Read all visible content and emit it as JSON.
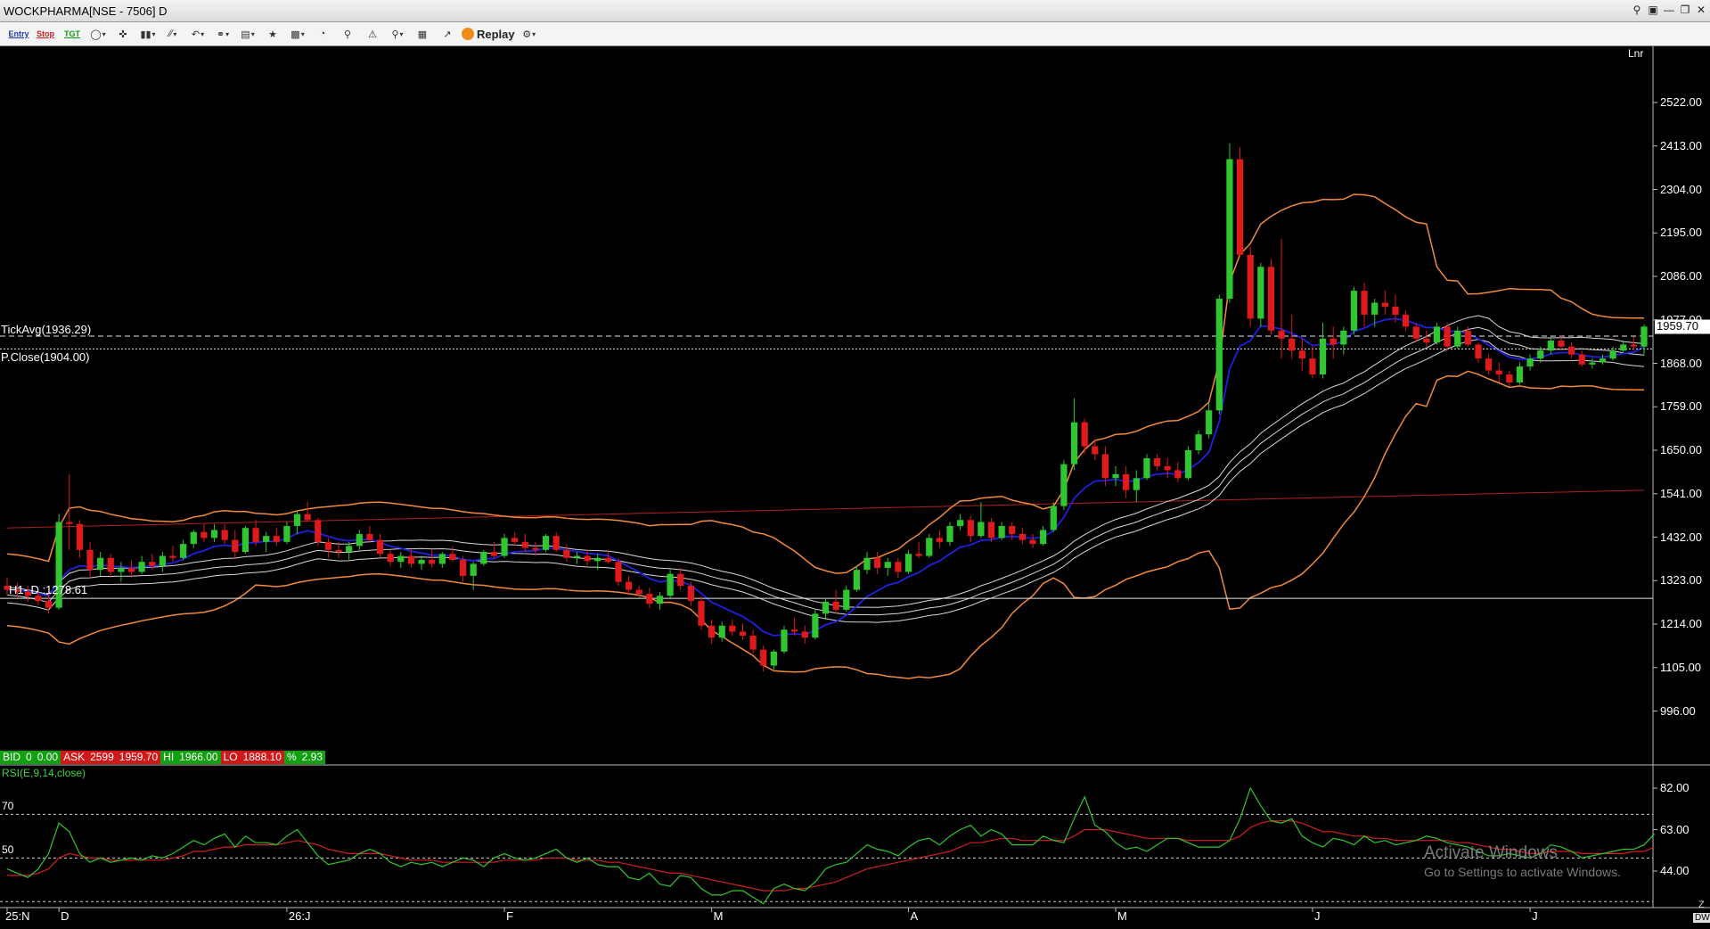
{
  "window": {
    "title": "WOCKPHARMA[NSE - 7506] D",
    "controls": [
      "search-icon",
      "monitor-icon",
      "minimize-icon",
      "restore-icon",
      "close-icon"
    ]
  },
  "toolbar": {
    "entry_label": "Entry",
    "stop_label": "Stop",
    "tgt_label": "TGT",
    "replay_label": "Replay",
    "icons": [
      "cursor-icon",
      "crosshair-icon",
      "bar-type-icon",
      "line-tools-icon",
      "undo-icon",
      "link-icon",
      "template-icon",
      "favorite-icon",
      "indicator-icon",
      "compare-icon",
      "scanner-icon",
      "alert-icon",
      "zoom-icon",
      "delete-icon",
      "study-icon",
      "settings-icon"
    ]
  },
  "colors": {
    "up": "#2fc62f",
    "down": "#e01a1a",
    "bollinger": "#f08a3c",
    "ema": "#2020e0",
    "envelope": "#d8d8d8",
    "longma": "#b02020",
    "rsi": "#2fc62f",
    "rsi_signal": "#d02020"
  },
  "chart_data": {
    "type": "candlestick",
    "symbol": "WOCKPHARMA[NSE - 7506] D",
    "scale_label": "Lnr",
    "y_axis_ticks": [
      "2522.00",
      "2413.00",
      "2304.00",
      "2195.00",
      "2086.00",
      "1977.00",
      "1868.00",
      "1759.00",
      "1650.00",
      "1541.00",
      "1432.00",
      "1323.00",
      "1214.00",
      "1105.00",
      "996.00"
    ],
    "ylim": [
      930,
      2600
    ],
    "x_axis_labels": [
      {
        "label": "25:N",
        "index": 0
      },
      {
        "label": "D",
        "index": 5
      },
      {
        "label": "26:J",
        "index": 27
      },
      {
        "label": "F",
        "index": 48
      },
      {
        "label": "M",
        "index": 68
      },
      {
        "label": "A",
        "index": 87
      },
      {
        "label": "M",
        "index": 107
      },
      {
        "label": "J",
        "index": 126
      },
      {
        "label": "J",
        "index": 147
      }
    ],
    "last_price": "1959.70",
    "reference_lines": [
      {
        "label": "TickAvg(1936.29)",
        "value": 1936.29,
        "style": "dashed"
      },
      {
        "label": "P.Close(1904.00)",
        "value": 1904.0,
        "style": "dotted"
      },
      {
        "label": "H1- D :1278.61",
        "value": 1278.61,
        "style": "solid"
      }
    ],
    "quote": {
      "bid_label": "BID",
      "bid_qty": "0",
      "bid_price": "0.00",
      "ask_label": "ASK",
      "ask_qty": "2599",
      "ask_price": "1959.70",
      "hi_label": "HI",
      "hi": "1966.00",
      "lo_label": "LO",
      "lo": "1888.10",
      "pct_label": "%",
      "pct": "2.93"
    },
    "candles": [
      [
        1310,
        1330,
        1285,
        1300
      ],
      [
        1300,
        1318,
        1280,
        1295
      ],
      [
        1295,
        1310,
        1270,
        1285
      ],
      [
        1285,
        1300,
        1262,
        1272
      ],
      [
        1272,
        1290,
        1240,
        1255
      ],
      [
        1255,
        1490,
        1250,
        1470
      ],
      [
        1470,
        1590,
        1400,
        1465
      ],
      [
        1465,
        1475,
        1380,
        1400
      ],
      [
        1400,
        1420,
        1330,
        1350
      ],
      [
        1350,
        1395,
        1335,
        1380
      ],
      [
        1380,
        1390,
        1330,
        1345
      ],
      [
        1345,
        1370,
        1320,
        1355
      ],
      [
        1355,
        1375,
        1330,
        1345
      ],
      [
        1345,
        1385,
        1340,
        1370
      ],
      [
        1370,
        1390,
        1350,
        1360
      ],
      [
        1360,
        1395,
        1345,
        1385
      ],
      [
        1385,
        1410,
        1370,
        1380
      ],
      [
        1380,
        1425,
        1375,
        1415
      ],
      [
        1415,
        1450,
        1405,
        1445
      ],
      [
        1445,
        1465,
        1420,
        1430
      ],
      [
        1430,
        1465,
        1420,
        1450
      ],
      [
        1450,
        1465,
        1415,
        1425
      ],
      [
        1425,
        1450,
        1380,
        1395
      ],
      [
        1395,
        1460,
        1390,
        1455
      ],
      [
        1455,
        1475,
        1410,
        1420
      ],
      [
        1420,
        1445,
        1395,
        1435
      ],
      [
        1435,
        1455,
        1410,
        1420
      ],
      [
        1420,
        1470,
        1415,
        1460
      ],
      [
        1460,
        1500,
        1440,
        1490
      ],
      [
        1490,
        1520,
        1470,
        1475
      ],
      [
        1475,
        1480,
        1410,
        1420
      ],
      [
        1420,
        1430,
        1380,
        1400
      ],
      [
        1400,
        1420,
        1380,
        1395
      ],
      [
        1395,
        1420,
        1375,
        1410
      ],
      [
        1410,
        1450,
        1400,
        1440
      ],
      [
        1440,
        1460,
        1420,
        1425
      ],
      [
        1425,
        1440,
        1380,
        1390
      ],
      [
        1390,
        1400,
        1360,
        1370
      ],
      [
        1370,
        1395,
        1355,
        1385
      ],
      [
        1385,
        1400,
        1355,
        1365
      ],
      [
        1365,
        1385,
        1350,
        1375
      ],
      [
        1375,
        1400,
        1355,
        1365
      ],
      [
        1365,
        1395,
        1355,
        1390
      ],
      [
        1390,
        1410,
        1370,
        1375
      ],
      [
        1375,
        1385,
        1320,
        1335
      ],
      [
        1335,
        1370,
        1300,
        1365
      ],
      [
        1365,
        1400,
        1360,
        1395
      ],
      [
        1395,
        1420,
        1380,
        1385
      ],
      [
        1385,
        1440,
        1380,
        1430
      ],
      [
        1430,
        1445,
        1410,
        1420
      ],
      [
        1420,
        1440,
        1395,
        1405
      ],
      [
        1405,
        1420,
        1385,
        1400
      ],
      [
        1400,
        1440,
        1395,
        1435
      ],
      [
        1435,
        1445,
        1395,
        1400
      ],
      [
        1400,
        1415,
        1370,
        1380
      ],
      [
        1380,
        1395,
        1365,
        1385
      ],
      [
        1385,
        1400,
        1360,
        1372
      ],
      [
        1372,
        1390,
        1350,
        1380
      ],
      [
        1380,
        1400,
        1365,
        1370
      ],
      [
        1370,
        1380,
        1310,
        1320
      ],
      [
        1320,
        1335,
        1290,
        1300
      ],
      [
        1300,
        1310,
        1280,
        1290
      ],
      [
        1290,
        1305,
        1255,
        1265
      ],
      [
        1265,
        1295,
        1250,
        1285
      ],
      [
        1285,
        1350,
        1280,
        1340
      ],
      [
        1340,
        1355,
        1300,
        1310
      ],
      [
        1310,
        1320,
        1260,
        1272
      ],
      [
        1272,
        1285,
        1200,
        1210
      ],
      [
        1210,
        1225,
        1165,
        1180
      ],
      [
        1180,
        1220,
        1170,
        1210
      ],
      [
        1210,
        1225,
        1185,
        1195
      ],
      [
        1195,
        1215,
        1175,
        1185
      ],
      [
        1185,
        1200,
        1140,
        1150
      ],
      [
        1150,
        1160,
        1095,
        1110
      ],
      [
        1110,
        1150,
        1100,
        1145
      ],
      [
        1145,
        1210,
        1140,
        1200
      ],
      [
        1200,
        1230,
        1185,
        1195
      ],
      [
        1195,
        1210,
        1165,
        1180
      ],
      [
        1180,
        1250,
        1175,
        1240
      ],
      [
        1240,
        1280,
        1225,
        1270
      ],
      [
        1270,
        1300,
        1240,
        1250
      ],
      [
        1250,
        1310,
        1245,
        1300
      ],
      [
        1300,
        1360,
        1295,
        1350
      ],
      [
        1350,
        1395,
        1340,
        1380
      ],
      [
        1380,
        1395,
        1340,
        1355
      ],
      [
        1355,
        1380,
        1335,
        1370
      ],
      [
        1370,
        1380,
        1330,
        1345
      ],
      [
        1345,
        1400,
        1340,
        1390
      ],
      [
        1390,
        1420,
        1380,
        1385
      ],
      [
        1385,
        1440,
        1380,
        1430
      ],
      [
        1430,
        1450,
        1405,
        1420
      ],
      [
        1420,
        1470,
        1410,
        1460
      ],
      [
        1460,
        1490,
        1450,
        1475
      ],
      [
        1475,
        1485,
        1420,
        1435
      ],
      [
        1435,
        1520,
        1430,
        1470
      ],
      [
        1470,
        1480,
        1420,
        1430
      ],
      [
        1430,
        1470,
        1425,
        1460
      ],
      [
        1460,
        1470,
        1425,
        1440
      ],
      [
        1440,
        1455,
        1415,
        1425
      ],
      [
        1425,
        1440,
        1405,
        1415
      ],
      [
        1415,
        1460,
        1410,
        1450
      ],
      [
        1450,
        1520,
        1445,
        1510
      ],
      [
        1510,
        1625,
        1500,
        1615
      ],
      [
        1615,
        1780,
        1600,
        1720
      ],
      [
        1720,
        1730,
        1640,
        1660
      ],
      [
        1660,
        1675,
        1625,
        1640
      ],
      [
        1640,
        1660,
        1560,
        1580
      ],
      [
        1580,
        1610,
        1560,
        1590
      ],
      [
        1590,
        1610,
        1530,
        1550
      ],
      [
        1550,
        1600,
        1520,
        1580
      ],
      [
        1580,
        1640,
        1575,
        1630
      ],
      [
        1630,
        1640,
        1600,
        1610
      ],
      [
        1610,
        1630,
        1580,
        1600
      ],
      [
        1600,
        1620,
        1570,
        1580
      ],
      [
        1580,
        1660,
        1575,
        1650
      ],
      [
        1650,
        1700,
        1640,
        1690
      ],
      [
        1690,
        1770,
        1680,
        1750
      ],
      [
        1750,
        2040,
        1740,
        2030
      ],
      [
        2030,
        2420,
        2020,
        2380
      ],
      [
        2380,
        2410,
        2135,
        2140
      ],
      [
        2140,
        2160,
        1960,
        1980
      ],
      [
        1980,
        2120,
        1960,
        2110
      ],
      [
        2110,
        2130,
        1940,
        1950
      ],
      [
        1950,
        2180,
        1880,
        1930
      ],
      [
        1930,
        1990,
        1880,
        1900
      ],
      [
        1900,
        1930,
        1850,
        1880
      ],
      [
        1880,
        1910,
        1830,
        1840
      ],
      [
        1840,
        1970,
        1830,
        1930
      ],
      [
        1930,
        1960,
        1880,
        1915
      ],
      [
        1915,
        1960,
        1890,
        1950
      ],
      [
        1950,
        2060,
        1940,
        2050
      ],
      [
        2050,
        2070,
        1960,
        1990
      ],
      [
        1990,
        2030,
        1960,
        2020
      ],
      [
        2020,
        2050,
        1990,
        2010
      ],
      [
        2010,
        2040,
        1970,
        1990
      ],
      [
        1990,
        2000,
        1950,
        1960
      ],
      [
        1960,
        1970,
        1920,
        1930
      ],
      [
        1930,
        1950,
        1910,
        1920
      ],
      [
        1920,
        1970,
        1915,
        1960
      ],
      [
        1960,
        1970,
        1900,
        1910
      ],
      [
        1910,
        1960,
        1905,
        1950
      ],
      [
        1950,
        1960,
        1910,
        1915
      ],
      [
        1915,
        1920,
        1870,
        1880
      ],
      [
        1880,
        1890,
        1840,
        1850
      ],
      [
        1850,
        1870,
        1820,
        1840
      ],
      [
        1840,
        1850,
        1810,
        1820
      ],
      [
        1820,
        1870,
        1815,
        1860
      ],
      [
        1860,
        1890,
        1850,
        1880
      ],
      [
        1880,
        1910,
        1870,
        1900
      ],
      [
        1900,
        1935,
        1890,
        1925
      ],
      [
        1925,
        1940,
        1900,
        1910
      ],
      [
        1910,
        1920,
        1880,
        1890
      ],
      [
        1890,
        1900,
        1860,
        1865
      ],
      [
        1865,
        1880,
        1855,
        1870
      ],
      [
        1870,
        1890,
        1865,
        1880
      ],
      [
        1880,
        1910,
        1875,
        1900
      ],
      [
        1900,
        1925,
        1895,
        1915
      ],
      [
        1915,
        1935,
        1900,
        1910
      ],
      [
        1910,
        1966,
        1890,
        1960
      ]
    ],
    "rsi": {
      "label": "RSI(E,9,14,close)",
      "ylim": [
        25,
        90
      ],
      "y_axis_ticks": [
        "82.00",
        "63.00",
        "44.00"
      ],
      "levels": [
        70,
        50
      ],
      "line": [
        45,
        43,
        41,
        45,
        52,
        66,
        62,
        52,
        48,
        50,
        48,
        49,
        50,
        49,
        51,
        50,
        52,
        55,
        58,
        56,
        59,
        61,
        55,
        60,
        57,
        57,
        56,
        60,
        63,
        57,
        51,
        47,
        48,
        49,
        52,
        54,
        52,
        48,
        46,
        48,
        47,
        48,
        46,
        48,
        50,
        49,
        46,
        50,
        52,
        50,
        49,
        50,
        52,
        54,
        50,
        48,
        50,
        47,
        46,
        46,
        41,
        40,
        43,
        38,
        37,
        42,
        41,
        36,
        33,
        33,
        35,
        35,
        32,
        29,
        36,
        38,
        36,
        35,
        39,
        45,
        47,
        48,
        52,
        56,
        54,
        53,
        51,
        55,
        58,
        59,
        56,
        60,
        63,
        65,
        60,
        63,
        61,
        56,
        56,
        56,
        60,
        58,
        57,
        68,
        78,
        65,
        62,
        57,
        54,
        55,
        53,
        56,
        59,
        59,
        57,
        55,
        55,
        55,
        58,
        68,
        82,
        74,
        67,
        66,
        68,
        60,
        57,
        55,
        59,
        58,
        56,
        60,
        57,
        58,
        56,
        57,
        58,
        60,
        59,
        57,
        56,
        55,
        53,
        51,
        51,
        52,
        51,
        50,
        52,
        56,
        55,
        53,
        50,
        51,
        52,
        53,
        54,
        54,
        56,
        61
      ],
      "signal": [
        42,
        42,
        42,
        43,
        45,
        50,
        52,
        51,
        50,
        50,
        49,
        49,
        49,
        49,
        49,
        49,
        50,
        51,
        53,
        53,
        54,
        55,
        55,
        56,
        56,
        56,
        56,
        57,
        58,
        57,
        56,
        54,
        53,
        52,
        52,
        52,
        52,
        51,
        50,
        49,
        49,
        49,
        48,
        48,
        48,
        48,
        48,
        48,
        49,
        49,
        49,
        49,
        50,
        50,
        50,
        49,
        49,
        49,
        48,
        48,
        47,
        46,
        45,
        44,
        43,
        43,
        42,
        41,
        40,
        39,
        38,
        37,
        36,
        35,
        35,
        35,
        36,
        36,
        37,
        38,
        39,
        41,
        43,
        45,
        46,
        47,
        48,
        49,
        50,
        51,
        52,
        53,
        55,
        57,
        57,
        58,
        59,
        59,
        58,
        58,
        58,
        58,
        58,
        60,
        63,
        63,
        63,
        62,
        61,
        60,
        59,
        59,
        59,
        59,
        58,
        58,
        58,
        58,
        58,
        60,
        64,
        66,
        67,
        67,
        67,
        66,
        64,
        62,
        62,
        61,
        60,
        60,
        59,
        59,
        58,
        58,
        58,
        58,
        58,
        58,
        57,
        57,
        56,
        55,
        54,
        54,
        53,
        52,
        52,
        53,
        53,
        53,
        52,
        52,
        52,
        52,
        52,
        53,
        53,
        55
      ]
    },
    "grid": false,
    "legend": "none"
  },
  "watermark": {
    "line1": "Activate Windows",
    "line2": "Go to Settings to activate Windows."
  },
  "corner": {
    "z_label": "Z",
    "period_label": "DW"
  }
}
